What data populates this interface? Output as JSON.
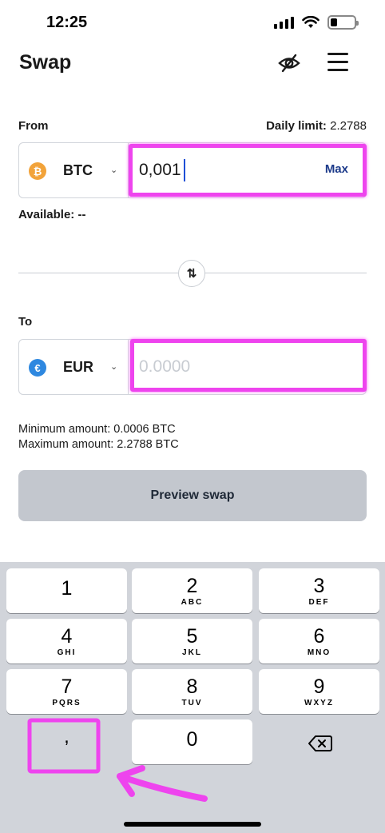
{
  "status_bar": {
    "time": "12:25"
  },
  "header": {
    "title": "Swap",
    "hide_balance_icon": "eye-slash-icon",
    "menu_icon": "hamburger-menu-icon"
  },
  "from": {
    "label": "From",
    "daily_limit_label": "Daily limit:",
    "daily_limit_value": "2.2788",
    "currency_code": "BTC",
    "currency_symbol": "₿",
    "amount_value": "0,001",
    "max_label": "Max",
    "available_label": "Available: --"
  },
  "swap_direction_icon": "swap-arrows-icon",
  "swap_direction_glyph": "⇅",
  "to": {
    "label": "To",
    "currency_code": "EUR",
    "currency_symbol": "€",
    "amount_placeholder": "0.0000"
  },
  "limits": {
    "minimum": "Minimum amount: 0.0006 BTC",
    "maximum": "Maximum amount: 2.2788 BTC"
  },
  "preview_button_label": "Preview swap",
  "keyboard": {
    "keys": [
      {
        "digit": "1",
        "letters": ""
      },
      {
        "digit": "2",
        "letters": "ABC"
      },
      {
        "digit": "3",
        "letters": "DEF"
      },
      {
        "digit": "4",
        "letters": "GHI"
      },
      {
        "digit": "5",
        "letters": "JKL"
      },
      {
        "digit": "6",
        "letters": "MNO"
      },
      {
        "digit": "7",
        "letters": "PQRS"
      },
      {
        "digit": "8",
        "letters": "TUV"
      },
      {
        "digit": "9",
        "letters": "WXYZ"
      }
    ],
    "decimal_key": ",",
    "zero_key": "0",
    "backspace_icon": "backspace-icon"
  },
  "colors": {
    "highlight": "#ee44ee",
    "btc": "#f2a33a",
    "eur": "#2e88e0",
    "max_link": "#1c3a8a",
    "preview_button_bg": "#c3c7ce",
    "keyboard_bg": "#d1d4da"
  }
}
